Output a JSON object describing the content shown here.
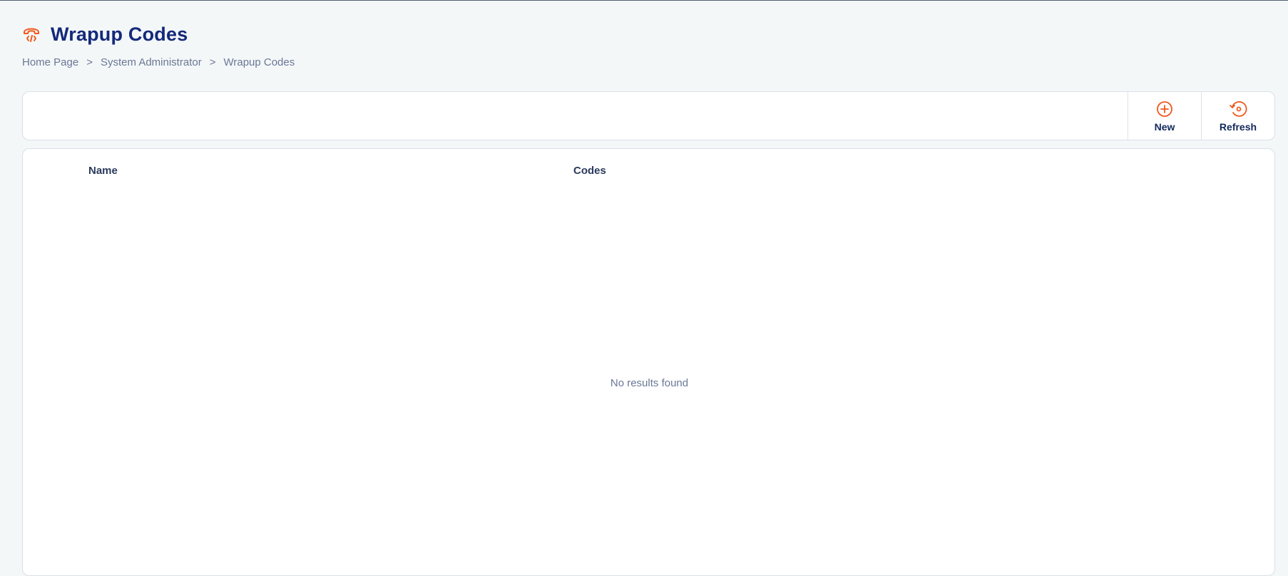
{
  "page": {
    "title": "Wrapup Codes",
    "title_icon": "phone-code-icon",
    "accent_color": "#f0581e",
    "title_color": "#13297a"
  },
  "breadcrumb": {
    "items": [
      "Home Page",
      "System Administrator",
      "Wrapup Codes"
    ],
    "separator": ">"
  },
  "toolbar": {
    "new_label": "New",
    "new_icon": "plus-circle-icon",
    "refresh_label": "Refresh",
    "refresh_icon": "refresh-icon"
  },
  "table": {
    "columns": [
      "Name",
      "Codes"
    ],
    "rows": [],
    "empty_message": "No results found"
  }
}
